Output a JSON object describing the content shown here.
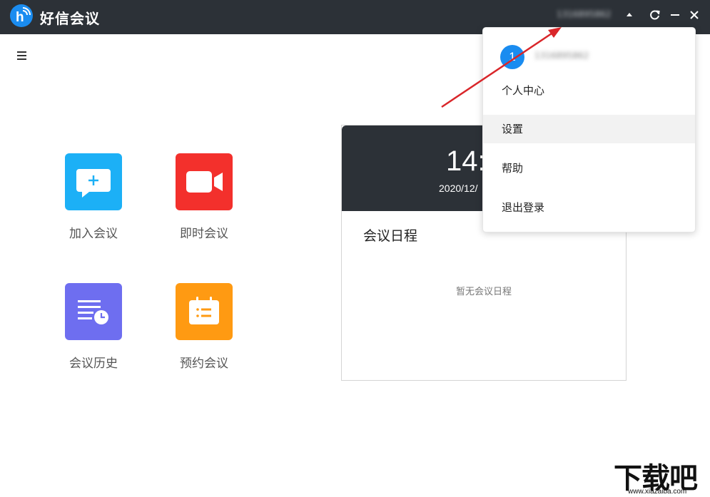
{
  "app": {
    "title": "好信会议"
  },
  "titlebar": {
    "account_name": "1316895862"
  },
  "tiles": [
    {
      "label": "加入会议",
      "color": "#1cb0f6",
      "icon": "chat-plus-icon"
    },
    {
      "label": "即时会议",
      "color": "#f3302c",
      "icon": "video-camera-icon"
    },
    {
      "label": "会议历史",
      "color": "#6e6ef0",
      "icon": "history-list-icon"
    },
    {
      "label": "预约会议",
      "color": "#ff9a12",
      "icon": "calendar-icon"
    }
  ],
  "schedule": {
    "time": "14:",
    "date": "2020/12/",
    "title": "会议日程",
    "empty": "暂无会议日程"
  },
  "dropdown": {
    "avatar_initial": "1",
    "username": "1316895862",
    "items": [
      {
        "label": "个人中心"
      },
      {
        "label": "设置"
      },
      {
        "label": "帮助"
      },
      {
        "label": "退出登录"
      }
    ]
  },
  "watermark": {
    "text": "下载吧",
    "url": "www.xiazaiba.com"
  }
}
